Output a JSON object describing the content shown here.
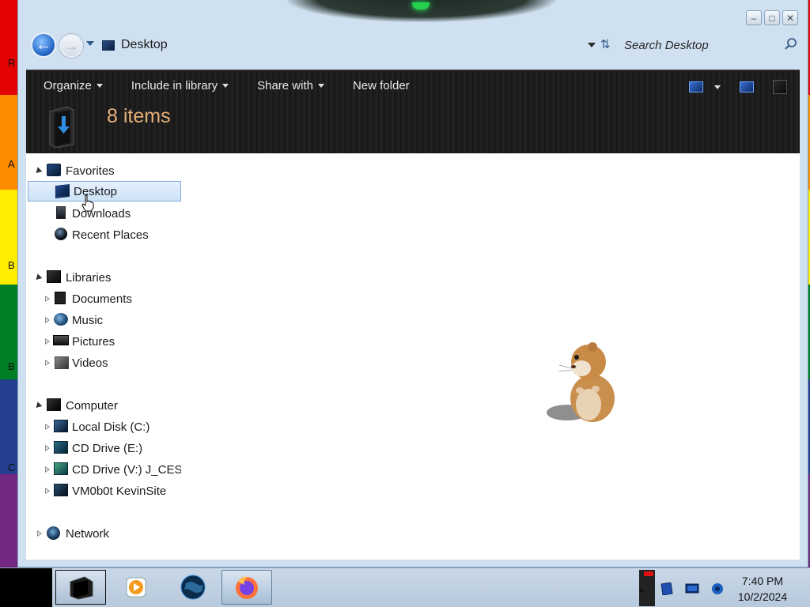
{
  "window": {
    "address": "Desktop",
    "search_placeholder": "Search Desktop",
    "caption_buttons": [
      "minimize",
      "maximize",
      "close"
    ]
  },
  "toolbar": {
    "organize": "Organize",
    "include_in_library": "Include in library",
    "share_with": "Share with",
    "new_folder": "New folder",
    "item_count": "8 items"
  },
  "navigation": {
    "favorites": {
      "label": "Favorites",
      "items": [
        "Desktop",
        "Downloads",
        "Recent Places"
      ],
      "selected": "Desktop"
    },
    "libraries": {
      "label": "Libraries",
      "items": [
        "Documents",
        "Music",
        "Pictures",
        "Videos"
      ]
    },
    "computer": {
      "label": "Computer",
      "items": [
        "Local Disk (C:)",
        "CD Drive (E:)",
        "CD Drive (V:) J_CESN",
        "VM0b0t KevinSite"
      ]
    },
    "network": {
      "label": "Network"
    }
  },
  "desktop_edge_letters": [
    "R",
    "A",
    "B",
    "B",
    "C"
  ],
  "rainbow_colors": [
    "#e40303",
    "#ff8c00",
    "#ffed00",
    "#008026",
    "#24408e",
    "#732982"
  ],
  "taskbar": {
    "apps": [
      "explorer-icon",
      "media-player-icon",
      "globe-icon",
      "firefox-icon"
    ],
    "tray_icons": [
      "action-center-icon",
      "display-icon",
      "network-icon"
    ],
    "time": "7:40 PM",
    "date": "10/2/2024"
  }
}
